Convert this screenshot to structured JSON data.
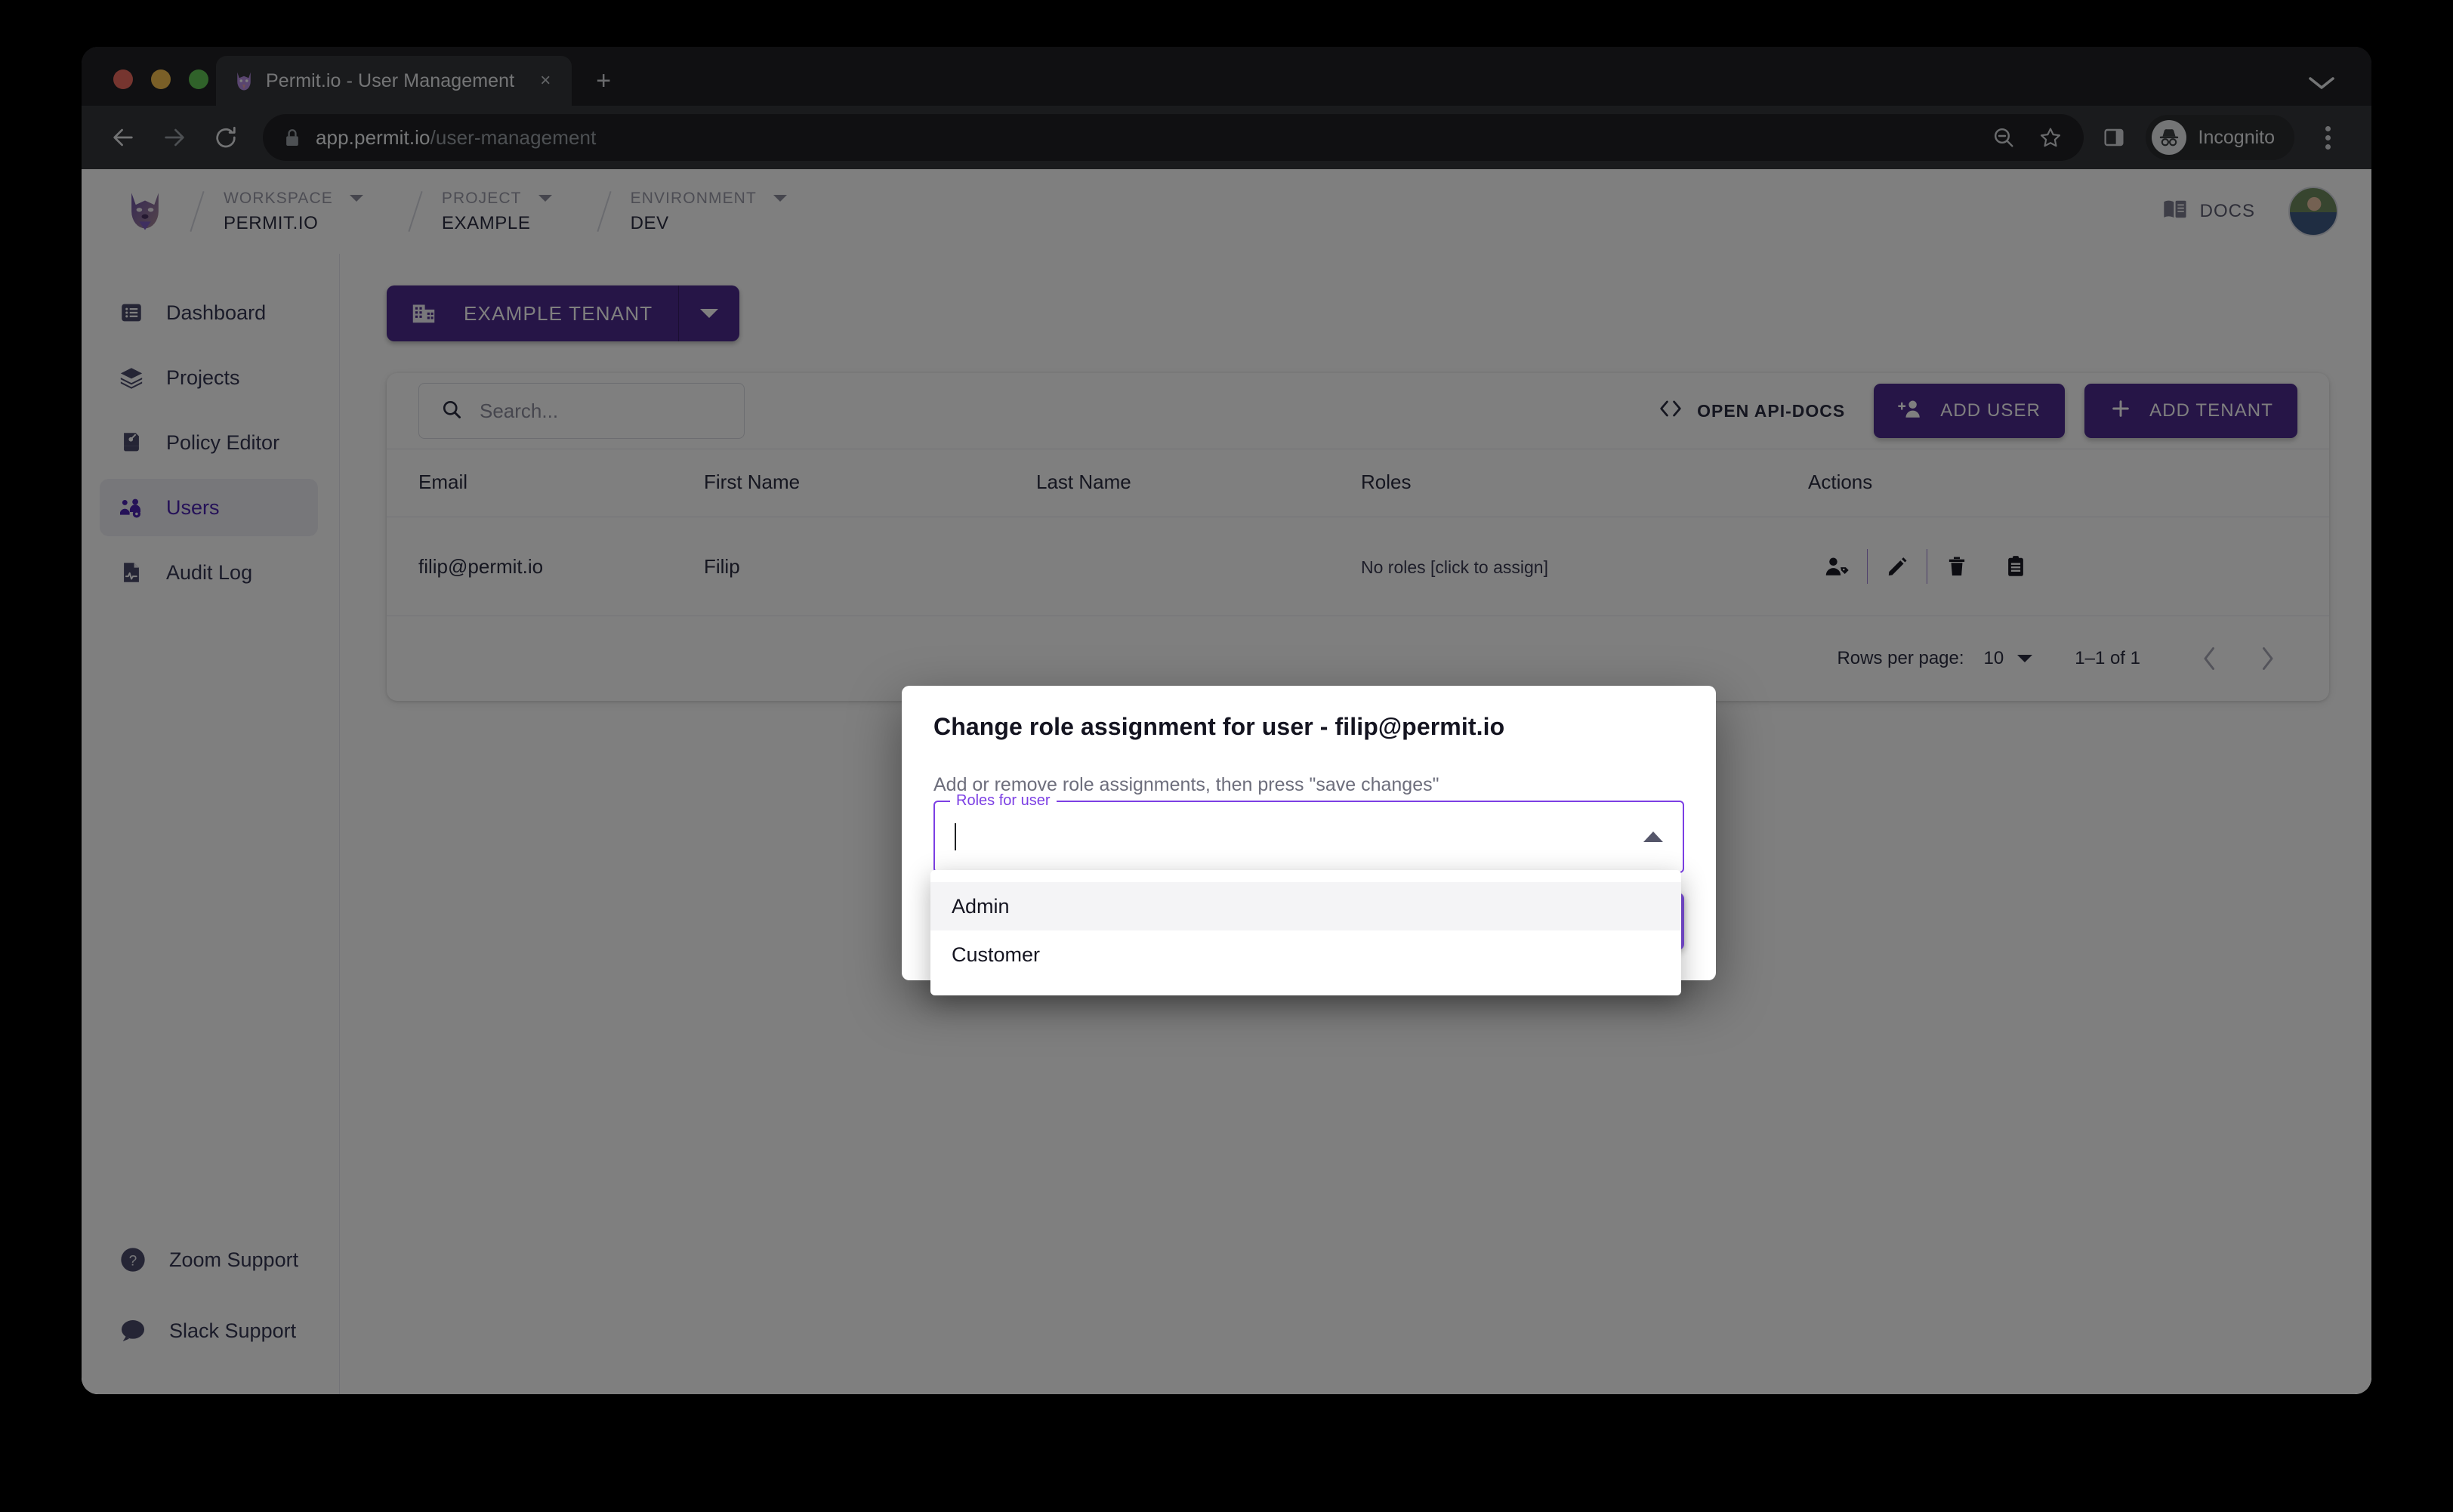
{
  "browser": {
    "tab": {
      "title": "Permit.io - User Management",
      "favicon": "permit-logo-icon",
      "close": "×"
    },
    "new_tab_label": "+",
    "tabstrip_menu_icon": "chevron-down-icon",
    "url": {
      "host": "app.permit.io",
      "path": "/user-management",
      "lock": "lock-icon"
    },
    "nav": {
      "back": "back-arrow-icon",
      "forward": "forward-arrow-icon",
      "reload": "reload-icon"
    },
    "toolbar": {
      "zoom_out_icon": "zoom-out-icon",
      "bookmark_icon": "star-icon",
      "side_panel_icon": "side-panel-icon",
      "profile_label": "Incognito",
      "profile_icon": "incognito-hat-icon",
      "menu_icon": "kebab-menu-icon"
    }
  },
  "header": {
    "logo": "permit-dog-logo",
    "groups": [
      {
        "label": "WORKSPACE",
        "value": "PERMIT.IO"
      },
      {
        "label": "PROJECT",
        "value": "EXAMPLE"
      },
      {
        "label": "ENVIRONMENT",
        "value": "DEV"
      }
    ],
    "docs_label": "DOCS",
    "docs_icon": "book-icon",
    "avatar": "user-avatar"
  },
  "sidebar": {
    "items": [
      {
        "label": "Dashboard",
        "icon": "dashboard-list-icon",
        "active": false
      },
      {
        "label": "Projects",
        "icon": "layers-icon",
        "active": false
      },
      {
        "label": "Policy Editor",
        "icon": "policy-pen-icon",
        "active": false
      },
      {
        "label": "Users",
        "icon": "users-gear-icon",
        "active": true
      },
      {
        "label": "Audit Log",
        "icon": "audit-file-icon",
        "active": false
      }
    ],
    "support": [
      {
        "label": "Zoom Support",
        "icon": "question-circle-icon"
      },
      {
        "label": "Slack Support",
        "icon": "chat-bubble-icon"
      }
    ]
  },
  "main": {
    "tenant_button": {
      "label": "EXAMPLE TENANT",
      "icon": "building-icon",
      "caret": "caret-down-icon"
    },
    "search": {
      "placeholder": "Search...",
      "value": "",
      "icon": "search-icon"
    },
    "api_docs": {
      "label": "OPEN API-DOCS",
      "icon": "code-brackets-icon"
    },
    "add_user": {
      "label": "ADD USER",
      "icon": "add-user-icon"
    },
    "add_tenant": {
      "label": "ADD TENANT",
      "icon": "plus-icon"
    },
    "table": {
      "columns": [
        "Email",
        "First Name",
        "Last Name",
        "Roles",
        "Actions"
      ],
      "rows": [
        {
          "email": "filip@permit.io",
          "first_name": "Filip",
          "last_name": "",
          "roles": "No roles [click to assign]",
          "actions": [
            "assign-role-icon",
            "edit-icon",
            "delete-icon",
            "copy-details-icon"
          ]
        }
      ]
    },
    "pagination": {
      "rows_per_page_label": "Rows per page:",
      "rows_per_page_value": "10",
      "range": "1–1 of 1",
      "prev_icon": "chevron-left-icon",
      "next_icon": "chevron-right-icon"
    }
  },
  "dialog": {
    "title": "Change role assignment for user - filip@permit.io",
    "subtitle": "Add or remove role assignments, then press \"save changes\"",
    "field_label": "Roles for user",
    "field_value": "",
    "field_arrow_icon": "caret-up-icon",
    "save_label": "",
    "options": [
      {
        "label": "Admin",
        "hovered": true
      },
      {
        "label": "Customer",
        "hovered": false
      }
    ]
  },
  "colors": {
    "brand_purple": "#4D2A8E",
    "accent_purple": "#7C3FE4",
    "save_purple": "#7C4DDB",
    "active_nav": "#4B23B0",
    "browser_chrome": "#202124",
    "toolbar": "#35363A"
  }
}
